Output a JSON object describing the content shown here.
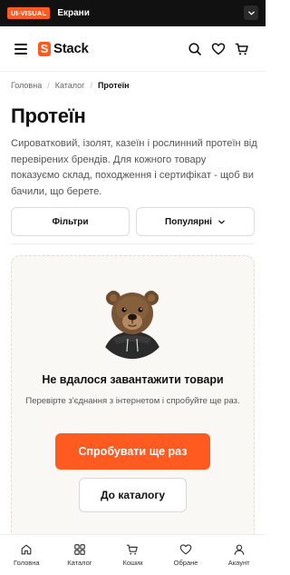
{
  "topbar": {
    "tag": "UI-VISUAL",
    "title": "Екрани"
  },
  "header": {
    "logo_text": "Stack",
    "logo_mark": "S"
  },
  "breadcrumb": {
    "items": [
      "Головна",
      "Каталог",
      "Протеїн"
    ]
  },
  "page": {
    "title": "Протеїн",
    "description": "Сироватковий, ізолят, казеїн і рослинний протеїн від перевірених брендів. Для кожного товару показуємо склад, походження і сертифікат - щоб ви бачили, що берете."
  },
  "filters": {
    "filter_label": "Фільтри",
    "sort_label": "Популярні"
  },
  "error": {
    "title": "Не вдалося завантажити товари",
    "text": "Перевірте з'єднання з інтернетом і спробуйте ще раз.",
    "retry_label": "Спробувати ще раз",
    "catalog_label": "До каталогу"
  },
  "bottom_nav": {
    "items": [
      {
        "label": "Головна",
        "icon": "home-icon"
      },
      {
        "label": "Каталог",
        "icon": "grid-icon"
      },
      {
        "label": "Кошик",
        "icon": "cart-icon"
      },
      {
        "label": "Обране",
        "icon": "heart-icon"
      },
      {
        "label": "Акаунт",
        "icon": "user-icon"
      }
    ]
  },
  "colors": {
    "accent": "#ff5a1f",
    "dark": "#111111",
    "card_bg": "#faf8f5"
  }
}
